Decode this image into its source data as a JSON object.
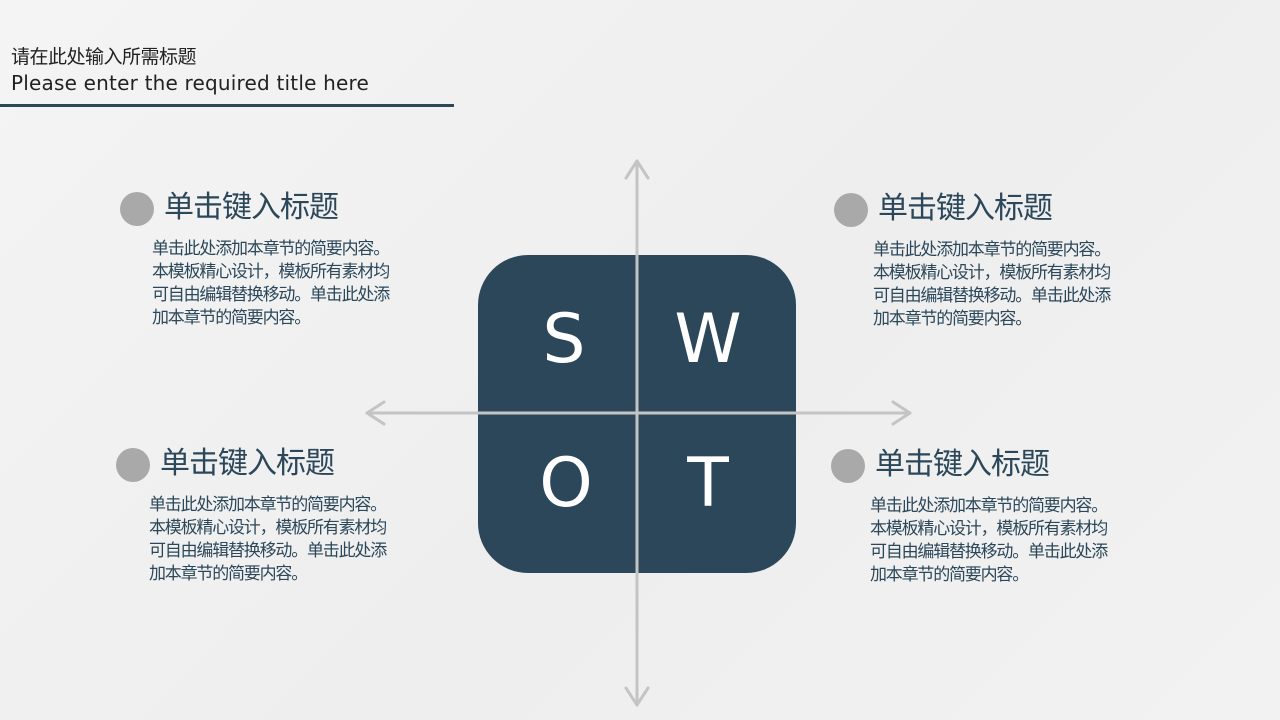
{
  "title": {
    "cn": "请在此处输入所需标题",
    "en": "Please enter the required title here"
  },
  "swot": {
    "s": "S",
    "w": "W",
    "o": "O",
    "t": "T"
  },
  "blocks": [
    {
      "heading": "单击键入标题",
      "body": "单击此处添加本章节的简要内容。\n本模板精心设计，模板所有素材均\n可自由编辑替换移动。单击此处添\n加本章节的简要内容。"
    },
    {
      "heading": "单击键入标题",
      "body": "单击此处添加本章节的简要内容。\n本模板精心设计，模板所有素材均\n可自由编辑替换移动。单击此处添\n加本章节的简要内容。"
    },
    {
      "heading": "单击键入标题",
      "body": "单击此处添加本章节的简要内容。\n本模板精心设计，模板所有素材均\n可自由编辑替换移动。单击此处添\n加本章节的简要内容。"
    },
    {
      "heading": "单击键入标题",
      "body": "单击此处添加本章节的简要内容。\n本模板精心设计，模板所有素材均\n可自由编辑替换移动。单击此处添\n加本章节的简要内容。"
    }
  ],
  "colors": {
    "accent": "#2b4759",
    "dot": "#a9a9a9",
    "axis": "#c4c4c4"
  }
}
